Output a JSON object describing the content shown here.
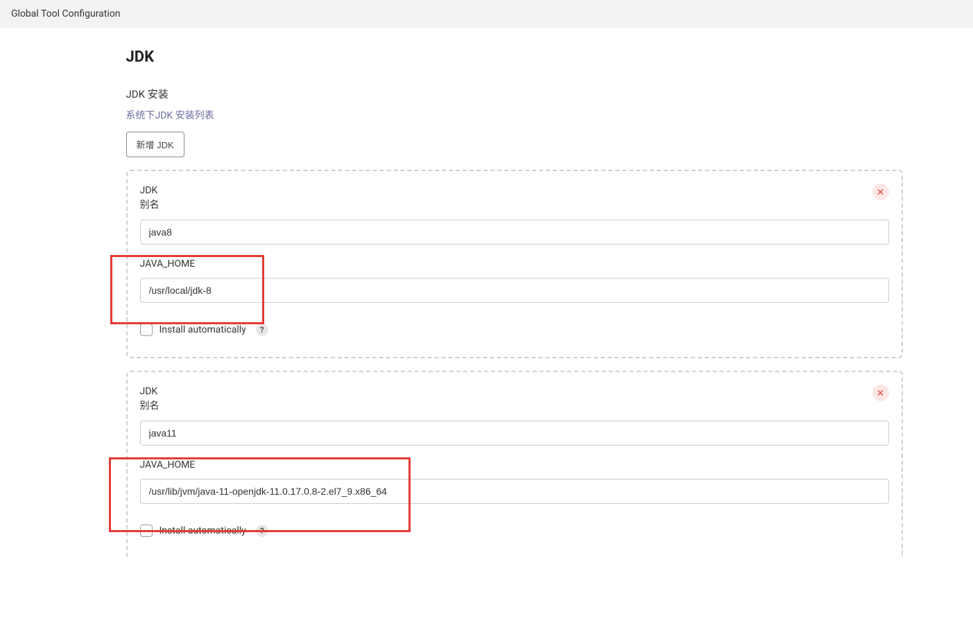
{
  "header": {
    "title": "Global Tool Configuration"
  },
  "section": {
    "title": "JDK",
    "installLabel": "JDK 安装",
    "installSubtitle": "系统下JDK 安装列表",
    "addButton": "新增 JDK"
  },
  "installations": [
    {
      "typeLabel": "JDK",
      "aliasLabel": "别名",
      "aliasValue": "java8",
      "javaHomeLabel": "JAVA_HOME",
      "javaHomeValue": "/usr/local/jdk-8",
      "installAutoLabel": "Install automatically",
      "helpSymbol": "?",
      "deleteSymbol": "✕"
    },
    {
      "typeLabel": "JDK",
      "aliasLabel": "别名",
      "aliasValue": "java11",
      "javaHomeLabel": "JAVA_HOME",
      "javaHomeValue": "/usr/lib/jvm/java-11-openjdk-11.0.17.0.8-2.el7_9.x86_64",
      "installAutoLabel": "Install automatically",
      "helpSymbol": "?",
      "deleteSymbol": "✕"
    }
  ]
}
